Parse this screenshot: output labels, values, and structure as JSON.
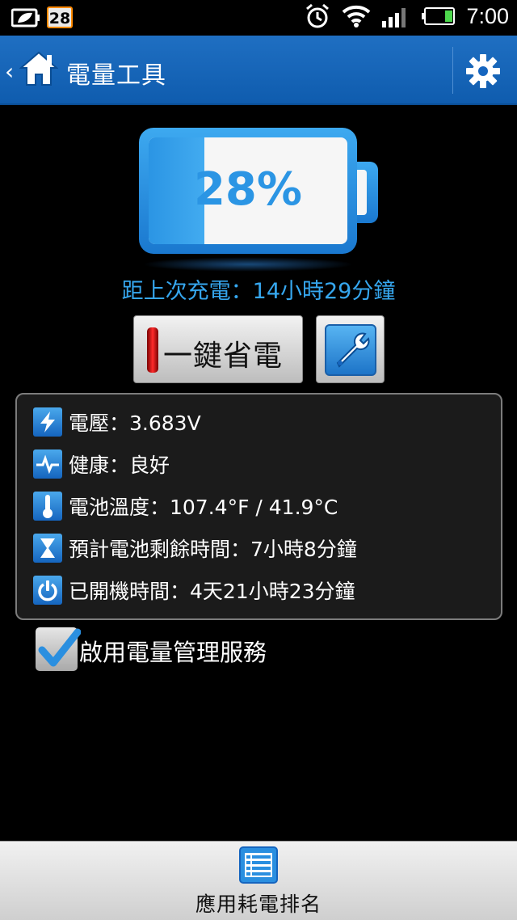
{
  "status_bar": {
    "notification_count": "28",
    "time": "7:00",
    "icons": [
      "leaf-battery-icon",
      "alarm-clock-icon",
      "wifi-icon",
      "signal-icon",
      "battery-icon"
    ]
  },
  "action_bar": {
    "back_glyph": "‹",
    "title": "電量工具",
    "icons": [
      "home-icon",
      "gear-icon"
    ]
  },
  "battery": {
    "percent_label": "28%",
    "level": 0.28,
    "colors": {
      "accent": "#2b95e4",
      "shell": "#1a78cf"
    }
  },
  "since_charge": "距上次充電：14小時29分鐘",
  "buttons": {
    "one_tap_save": "一鍵省電",
    "tools_icon": "wrench-icon"
  },
  "info": {
    "rows": [
      {
        "icon": "lightning-icon",
        "text": "電壓：3.683V"
      },
      {
        "icon": "pulse-icon",
        "text": "健康：良好"
      },
      {
        "icon": "thermometer-icon",
        "text": "電池溫度：107.4°F / 41.9°C"
      },
      {
        "icon": "hourglass-icon",
        "text": "預計電池剩餘時間：7小時8分鐘"
      },
      {
        "icon": "power-icon",
        "text": "已開機時間：4天21小時23分鐘"
      }
    ]
  },
  "service_checkbox": {
    "label": "啟用電量管理服務",
    "checked": true
  },
  "bottom_bar": {
    "label": "應用耗電排名",
    "icon": "list-icon"
  }
}
